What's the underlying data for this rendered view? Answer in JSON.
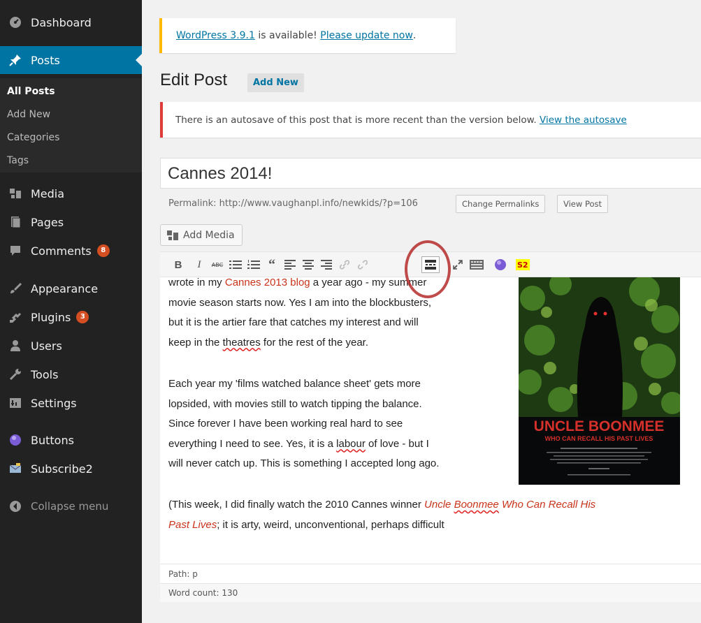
{
  "sidebar": {
    "items": [
      {
        "label": "Dashboard",
        "icon": "dashboard-icon"
      },
      {
        "label": "Posts",
        "icon": "pin-icon"
      },
      {
        "label": "Media",
        "icon": "media-icon"
      },
      {
        "label": "Pages",
        "icon": "pages-icon"
      },
      {
        "label": "Comments",
        "icon": "comments-icon",
        "badge": "8"
      },
      {
        "label": "Appearance",
        "icon": "paintbrush-icon"
      },
      {
        "label": "Plugins",
        "icon": "plugin-icon",
        "badge": "3"
      },
      {
        "label": "Users",
        "icon": "users-icon"
      },
      {
        "label": "Tools",
        "icon": "wrench-icon"
      },
      {
        "label": "Settings",
        "icon": "settings-icon"
      },
      {
        "label": "Buttons",
        "icon": "purple-circle-icon"
      },
      {
        "label": "Subscribe2",
        "icon": "envelope-icon"
      }
    ],
    "submenu": [
      "All Posts",
      "Add New",
      "Categories",
      "Tags"
    ],
    "collapse": "Collapse menu"
  },
  "update_notice": {
    "link1": "WordPress 3.9.1",
    "middle": " is available! ",
    "link2": "Please update now",
    "end": "."
  },
  "page": {
    "title": "Edit Post",
    "add_new": "Add New"
  },
  "autosave_notice": {
    "text": "There is an autosave of this post that is more recent than the version below. ",
    "link": "View the autosave"
  },
  "post": {
    "title": "Cannes 2014!",
    "permalink_label": "Permalink: http://www.vaughanpl.info/newkids/?p=106",
    "change_permalinks": "Change Permalinks",
    "view_post": "View Post",
    "add_media": "Add Media"
  },
  "toolbar": {
    "bold": "B",
    "italic": "I",
    "strike": "ABC",
    "s2": "S2"
  },
  "content": {
    "p1_l1_a": "wrote in my ",
    "p1_l1_link": "Cannes 2013 blog",
    "p1_l1_b": " a year ago - my summer",
    "p1_l2": "movie season starts now. Yes I am into the blockbusters,",
    "p1_l3": "but it is the artier fare that catches my interest and will",
    "p1_l4_a": "keep in the ",
    "p1_l4_sq": "theatres",
    "p1_l4_b": " for the rest of the year.",
    "p2_l1": "Each year my 'films watched balance sheet' gets more",
    "p2_l2": "lopsided, with movies still to watch tipping the balance.",
    "p2_l3": "Since forever I have been working real hard to see",
    "p2_l4_a": "everything I need to see. Yes, it is a ",
    "p2_l4_sq": "labour",
    "p2_l4_b": " of love - but I",
    "p2_l5": "will never catch up. This is something I accepted long ago.",
    "p3_l1_a": "(This week, I did finally watch the 2010 Cannes winner ",
    "p3_l1_i1": "Uncle ",
    "p3_l1_sq": "Boonmee",
    "p3_l1_i2": " Who Can Recall His",
    "p3_l2_i": "Past Lives",
    "p3_l2_b": "; it is arty, weird, unconventional, perhaps difficult",
    "poster_title": "UNCLE BOONMEE",
    "poster_subtitle": "WHO CAN RECALL HIS PAST LIVES"
  },
  "status": {
    "path": "Path: p",
    "word_count": "Word count: 130"
  },
  "colors": {
    "sidebar_bg": "#222222",
    "active": "#0074a2",
    "badge": "#d54e21",
    "annotation_oval": "#b52c2c"
  }
}
